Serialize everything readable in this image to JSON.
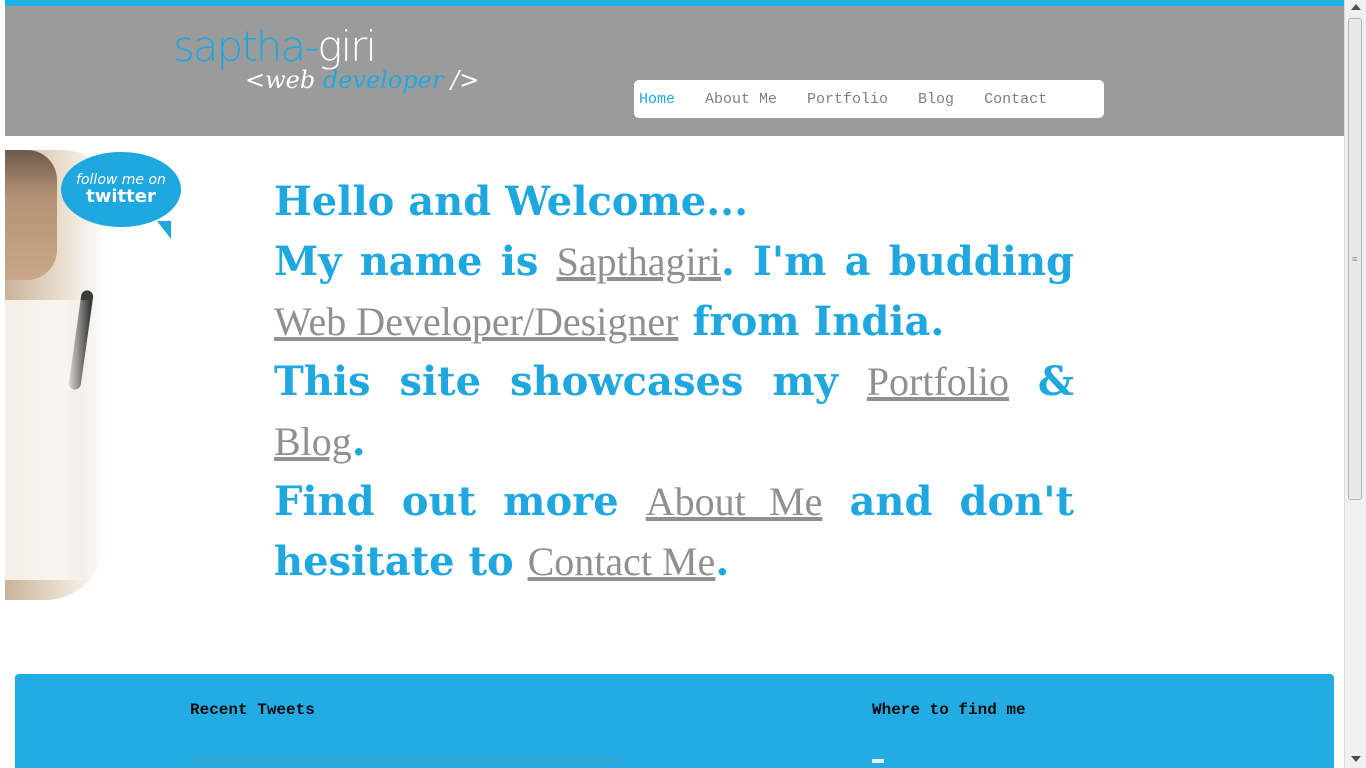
{
  "header": {
    "logo_part1": "saptha-",
    "logo_part2": "giri",
    "tagline_open": "<",
    "tagline_word1": "web",
    "tagline_word2": "developer",
    "tagline_close": "/>"
  },
  "nav": {
    "items": [
      {
        "label": "Home",
        "active": true
      },
      {
        "label": "About Me",
        "active": false
      },
      {
        "label": "Portfolio",
        "active": false
      },
      {
        "label": "Blog",
        "active": false
      },
      {
        "label": "Contact",
        "active": false
      }
    ]
  },
  "twitter_badge": {
    "line1": "follow me on",
    "line2": "twitter"
  },
  "intro": {
    "l1": "Hello and Welcome...",
    "l2a": "My name is ",
    "l2link": "Sapthagiri",
    "l2b": ". I'm a budding ",
    "l3link": "Web Developer/Designer",
    "l3b": " from India.",
    "l4a": "This site showcases my ",
    "l4link1": "Portfolio",
    "l4b": " & ",
    "l4link2": "Blog",
    "l4c": ".",
    "l5a": "Find out more ",
    "l5link": "About Me",
    "l5b": " and don't hesitate to ",
    "l6link": "Contact Me",
    "l6b": "."
  },
  "footer": {
    "recent_tweets": "Recent Tweets",
    "where_to_find": "Where to find me"
  },
  "colors": {
    "accent": "#1fa8df",
    "header_bg": "#9b9b9b",
    "link_gray": "#909090"
  }
}
